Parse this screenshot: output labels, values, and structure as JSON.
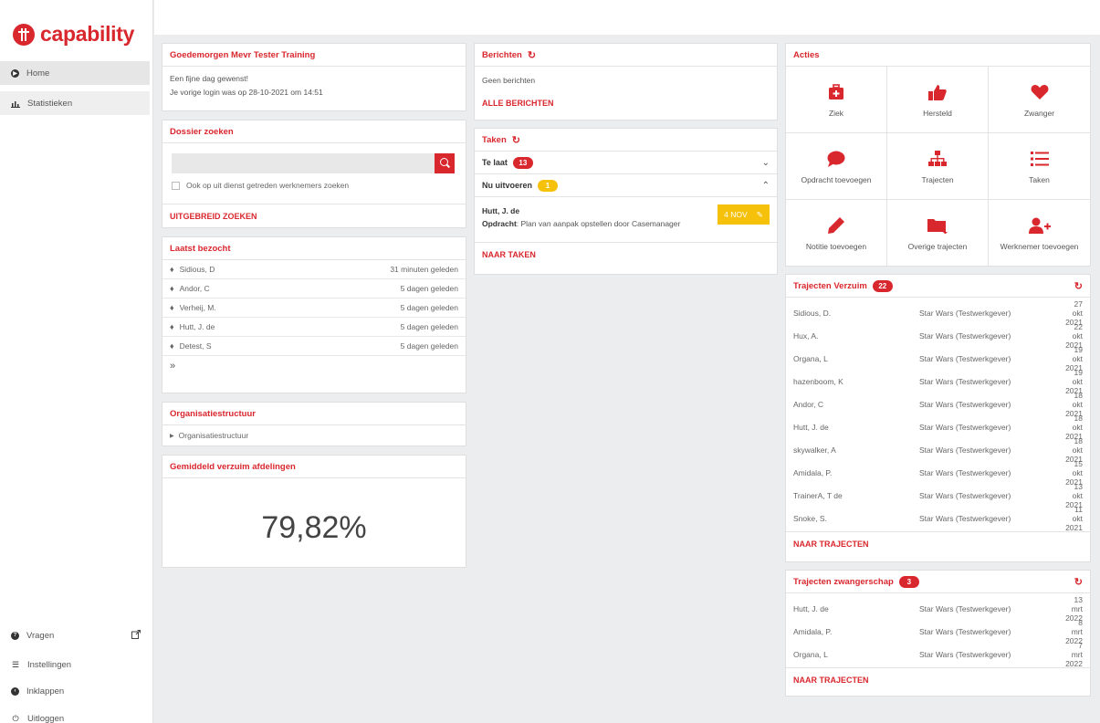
{
  "app": {
    "logo_text": "capability",
    "brand_color": "#d9272e",
    "warning_color": "#f5c10b"
  },
  "sidebar": {
    "top_items": [
      {
        "label": "Home",
        "icon": "play-circle-icon",
        "active": true
      },
      {
        "label": "Statistieken",
        "icon": "bar-chart-icon",
        "active": false
      }
    ],
    "bottom_items": [
      {
        "label": "Vragen",
        "icon": "question-circle-icon"
      },
      {
        "label": "Instellingen",
        "icon": "list-icon"
      },
      {
        "label": "Inklappen",
        "icon": "chevron-left-circle-icon"
      },
      {
        "label": "Uitloggen",
        "icon": "power-icon"
      }
    ]
  },
  "welcome": {
    "title": "Goedemorgen Mevr Tester Training",
    "line1": "Een fijne dag gewenst!",
    "line2": "Je vorige login was op 28-10-2021 om 14:51"
  },
  "dossier": {
    "title": "Dossier zoeken",
    "search_value": "",
    "checkbox_label": "Ook op uit dienst getreden werknemers zoeken",
    "advanced_link": "UITGEBREID ZOEKEN"
  },
  "recent": {
    "title": "Laatst bezocht",
    "items": [
      {
        "name": "Sidious, D",
        "time": "31 minuten geleden"
      },
      {
        "name": "Andor, C",
        "time": "5 dagen geleden"
      },
      {
        "name": "Verheij, M.",
        "time": "5 dagen geleden"
      },
      {
        "name": "Hutt, J. de",
        "time": "5 dagen geleden"
      },
      {
        "name": "Detest, S",
        "time": "5 dagen geleden"
      }
    ],
    "more": "»"
  },
  "org": {
    "title": "Organisatiestructuur",
    "item": "Organisatiestructuur"
  },
  "absence": {
    "title": "Gemiddeld verzuim afdelingen",
    "value": "79,82%"
  },
  "messages": {
    "title": "Berichten",
    "empty": "Geen berichten",
    "link": "ALLE BERICHTEN"
  },
  "tasks": {
    "title": "Taken",
    "late_label": "Te laat",
    "late_count": "13",
    "now_label": "Nu uitvoeren",
    "now_count": "1",
    "item": {
      "name": "Hutt, J. de",
      "desc_label": "Opdracht",
      "desc": ": Plan van aanpak opstellen door Casemanager",
      "date": "4 NOV"
    },
    "link": "NAAR TAKEN"
  },
  "actions": {
    "title": "Acties",
    "items": [
      {
        "label": "Ziek",
        "icon": "medkit-icon"
      },
      {
        "label": "Hersteld",
        "icon": "thumbs-up-icon"
      },
      {
        "label": "Zwanger",
        "icon": "heart-icon"
      },
      {
        "label": "Opdracht toevoegen",
        "icon": "comment-icon"
      },
      {
        "label": "Trajecten",
        "icon": "sitemap-icon"
      },
      {
        "label": "Taken",
        "icon": "list-icon"
      },
      {
        "label": "Notitie toevoegen",
        "icon": "pencil-icon"
      },
      {
        "label": "Overige trajecten",
        "icon": "folder-icon"
      },
      {
        "label": "Werknemer toevoegen",
        "icon": "user-plus-icon"
      }
    ]
  },
  "traj_verzuim": {
    "title": "Trajecten Verzuim",
    "count": "22",
    "rows": [
      {
        "name": "Sidious, D.",
        "employer": "Star Wars (Testwerkgever)",
        "date": "27 okt 2021"
      },
      {
        "name": "Hux, A.",
        "employer": "Star Wars (Testwerkgever)",
        "date": "22 okt 2021"
      },
      {
        "name": "Organa, L",
        "employer": "Star Wars (Testwerkgever)",
        "date": "19 okt 2021"
      },
      {
        "name": "hazenboom, K",
        "employer": "Star Wars (Testwerkgever)",
        "date": "19 okt 2021"
      },
      {
        "name": "Andor, C",
        "employer": "Star Wars (Testwerkgever)",
        "date": "18 okt 2021"
      },
      {
        "name": "Hutt, J. de",
        "employer": "Star Wars (Testwerkgever)",
        "date": "18 okt 2021"
      },
      {
        "name": "skywalker, A",
        "employer": "Star Wars (Testwerkgever)",
        "date": "18 okt 2021"
      },
      {
        "name": "Amidala, P.",
        "employer": "Star Wars (Testwerkgever)",
        "date": "15 okt 2021"
      },
      {
        "name": "TrainerA, T de",
        "employer": "Star Wars (Testwerkgever)",
        "date": "13 okt 2021"
      },
      {
        "name": "Snoke, S.",
        "employer": "Star Wars (Testwerkgever)",
        "date": "11 okt 2021"
      }
    ],
    "link": "NAAR TRAJECTEN"
  },
  "traj_zwanger": {
    "title": "Trajecten zwangerschap",
    "count": "3",
    "rows": [
      {
        "name": "Hutt, J. de",
        "employer": "Star Wars (Testwerkgever)",
        "date": "13 mrt 2022"
      },
      {
        "name": "Amidala, P.",
        "employer": "Star Wars (Testwerkgever)",
        "date": "8 mrt 2022"
      },
      {
        "name": "Organa, L",
        "employer": "Star Wars (Testwerkgever)",
        "date": "7 mrt 2022"
      }
    ],
    "link": "NAAR TRAJECTEN"
  }
}
